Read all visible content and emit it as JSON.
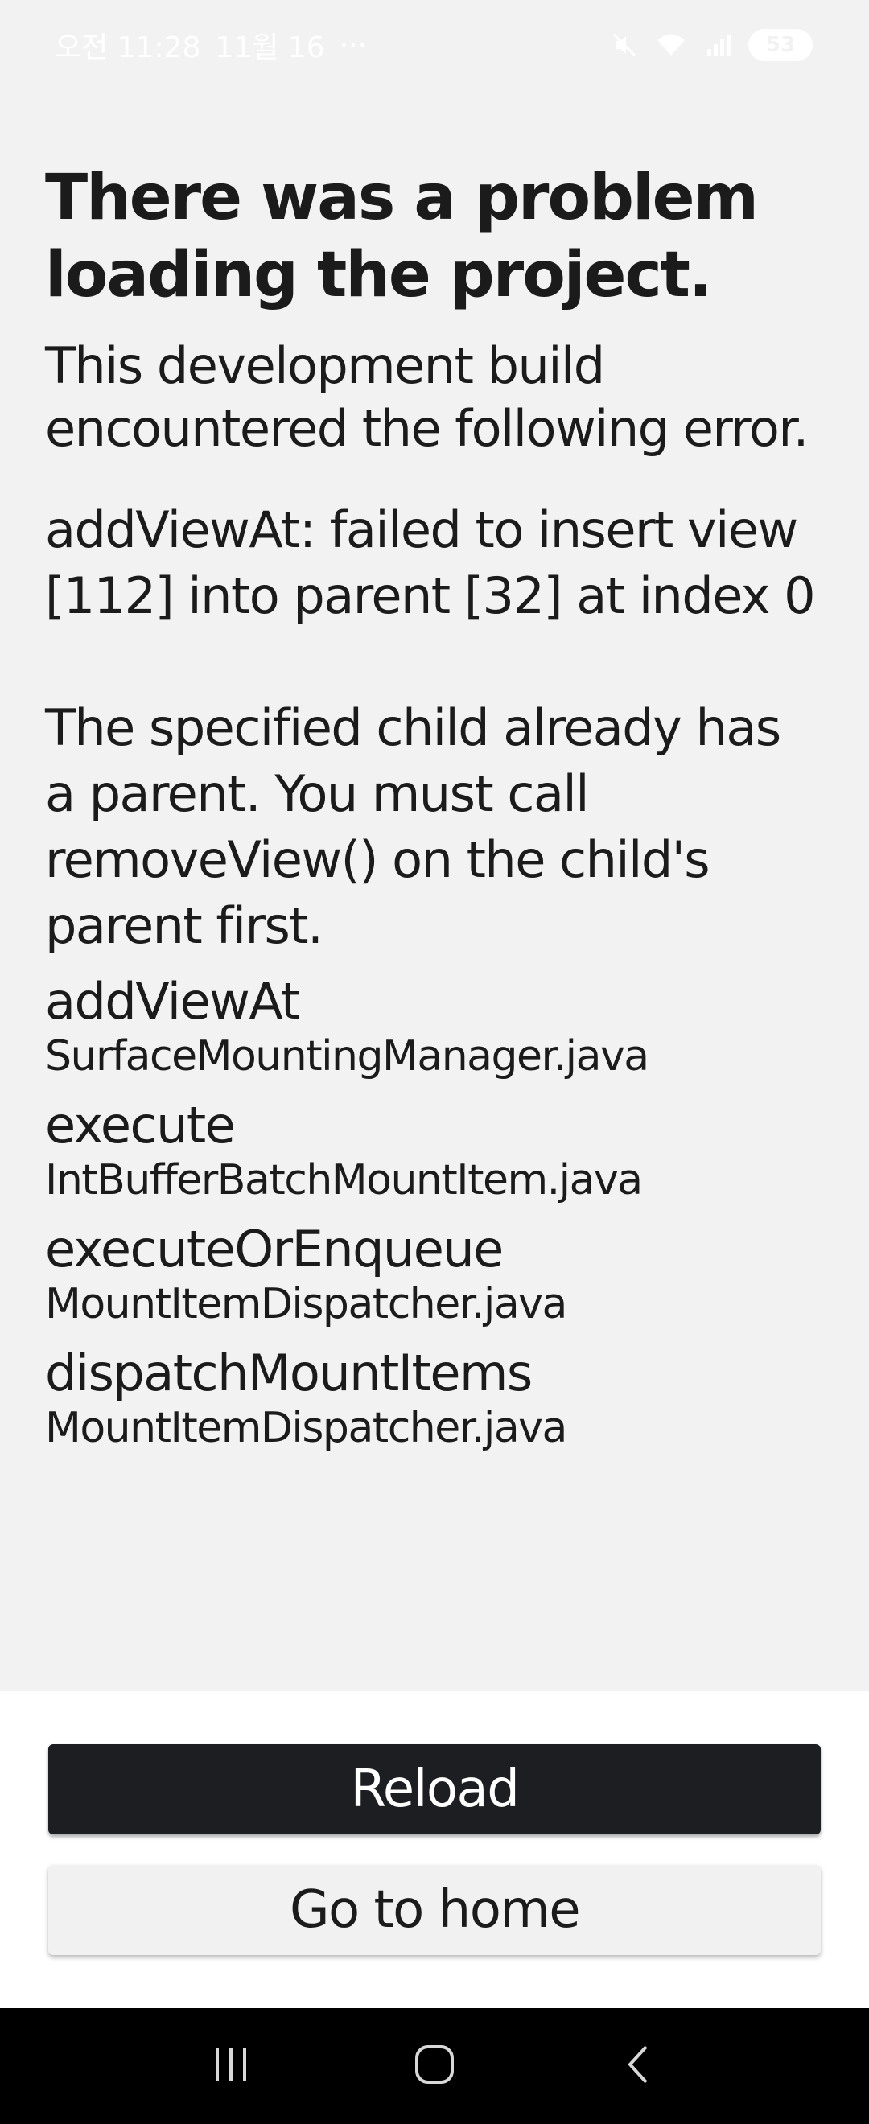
{
  "status_bar": {
    "time": "오전 11:28",
    "date": "11월 16",
    "extra": "···",
    "battery": "53",
    "icons": [
      "mute-icon",
      "wifi-icon",
      "signal-icon",
      "battery-icon"
    ]
  },
  "error_screen": {
    "title": "There was a problem loading the project.",
    "subtitle": "This development build encountered the following error.",
    "message": "addViewAt: failed to insert view [112] into parent [32] at index 0\n\nThe specified child already has a parent. You must call removeView() on the child's parent first.",
    "stack": [
      {
        "method": "addViewAt",
        "file": "SurfaceMountingManager.java"
      },
      {
        "method": "execute",
        "file": "IntBufferBatchMountItem.java"
      },
      {
        "method": "executeOrEnqueue",
        "file": "MountItemDispatcher.java"
      },
      {
        "method": "dispatchMountItems",
        "file": "MountItemDispatcher.java"
      }
    ]
  },
  "buttons": {
    "reload_label": "Reload",
    "home_label": "Go to home"
  },
  "nav_bar": {
    "icons": [
      "recent-apps-icon",
      "home-icon",
      "back-icon"
    ]
  },
  "colors": {
    "background": "#f2f2f2",
    "reload_button": "#1d1e22",
    "home_button": "#f1f1f1",
    "text": "#1b1b1b",
    "nav_bar": "#000000"
  }
}
